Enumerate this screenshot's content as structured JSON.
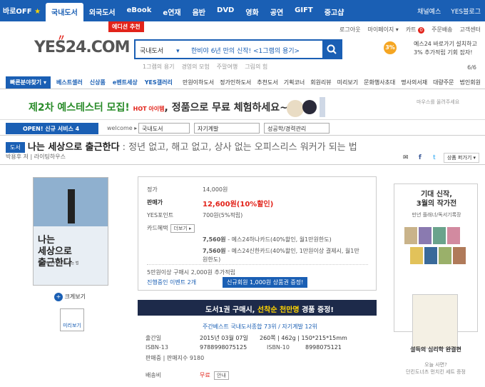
{
  "topbar": {
    "off_label": "바로OFF",
    "nav": [
      "국내도서",
      "외국도서",
      "eBook",
      "e연재",
      "음반",
      "DVD",
      "영화",
      "공연",
      "GIFT",
      "중고샵"
    ],
    "right": [
      "채널예스",
      "YES블로그"
    ]
  },
  "badge_new": "에디션 추천",
  "util": [
    "로그아웃",
    "마이페이지 ▾",
    "카트",
    "주문배송",
    "고객센터"
  ],
  "cart_count": "0",
  "logo": {
    "text": "YES24.COM"
  },
  "search": {
    "category": "국내도서",
    "query": "한비야 6년 만의 신작! <1그램의 용기>",
    "hot": [
      "1그램의 용기",
      "경영의 모험",
      "주말여행",
      "그림의 힘"
    ]
  },
  "promo_right": {
    "circle": "3%",
    "line1": "예스24 바로가기 설치하고",
    "line2": "3% 추가적립 기회 잡자!"
  },
  "pager": "6/6",
  "catnav": {
    "first": "빠른분야찾기 ▾",
    "left": [
      "베스트셀러",
      "신상품",
      "e벤트세상",
      "YES갤러리"
    ],
    "right": [
      "만원이하도서",
      "정가인하도서",
      "추천도서",
      "기획코너",
      "회원리뷰",
      "미리보기",
      "문화행사초대",
      "명사의서재",
      "대량주문",
      "법인회원"
    ]
  },
  "banner": {
    "part1": "제2차 예스테스터 모집! ",
    "hot": "HOT 아이템",
    "part2": ", 정품으로 무료 체험하세요~",
    "mouse": "마우스를 올려주세요"
  },
  "crumb": {
    "open": "OPEN! 신규 서비스 4",
    "welcome": "welcome ▸",
    "sel1": "국내도서",
    "sel2": "자기계발",
    "sel3": "성공학/경력관리"
  },
  "book": {
    "tag": "도서",
    "title": "나는 세상으로 출근한다",
    "subtitle": ": 정년 없고, 해고 없고, 상사 없는 오피스리스 워커가 되는 법",
    "byline": "박용후 저 | 라이팅하우스",
    "cover_title": "나는\n세상으로\n출근한다",
    "cover_sub": "오피스리스 워커가 되는 법"
  },
  "share": {
    "scrap": "상품 퍼가기 ▾"
  },
  "zoom": "크게보기",
  "preview": "미리보기",
  "price": {
    "list_label": "정가",
    "list_value": "14,000원",
    "sale_label": "판매가",
    "sale_value": "12,600원(10%할인)",
    "point_label": "YES포인트",
    "point_value": "700원(5%적립)",
    "card_label": "카드혜택",
    "card_more": "더보기 ▸",
    "card1_amt": "7,560원",
    "card1_desc": " - 예스24하나카드(40%할인, 월1만원한도)",
    "card2_amt": "7,560원",
    "card2_desc": " - 예스24신한카드(40%할인, 1만원이상 결제시, 월1만",
    "card2_cont": "원한도)",
    "extra": "5만원이상 구매시 2,000원 추가적립",
    "event": "진행중인 이벤트 2개",
    "coupon": "신규회원 1,000원 상품권 증정!"
  },
  "ad": {
    "part1": "도서1권 구매시, ",
    "hl": "선착순 천만명",
    "part2": " 경품 증정!"
  },
  "detail": {
    "rank": "주간베스트 국내도서종합 73위 / 자기계발 12위",
    "pub_label": "출간일",
    "pub_value": "2015년 03월 07일",
    "pages": "260쪽 | 462g | 150*215*15mm",
    "isbn13_label": "ISBN-13",
    "isbn13": "9788998075125",
    "isbn10_label": "ISBN-10",
    "isbn10": "8998075121",
    "sales": "판매중 | 판매지수 9180",
    "ship_label": "배송비",
    "ship_value": "무료",
    "ship_more": "안내"
  },
  "side1": {
    "h1": "기대 신작,",
    "h2": "3월의 작가전",
    "s": "만년 플래너/독서기록장"
  },
  "side2": {
    "t1": "설득의 심리학 완결편",
    "t2a": "오늘 사면?",
    "t2b": "던킨도너츠 먼치킨 세트 증정"
  }
}
